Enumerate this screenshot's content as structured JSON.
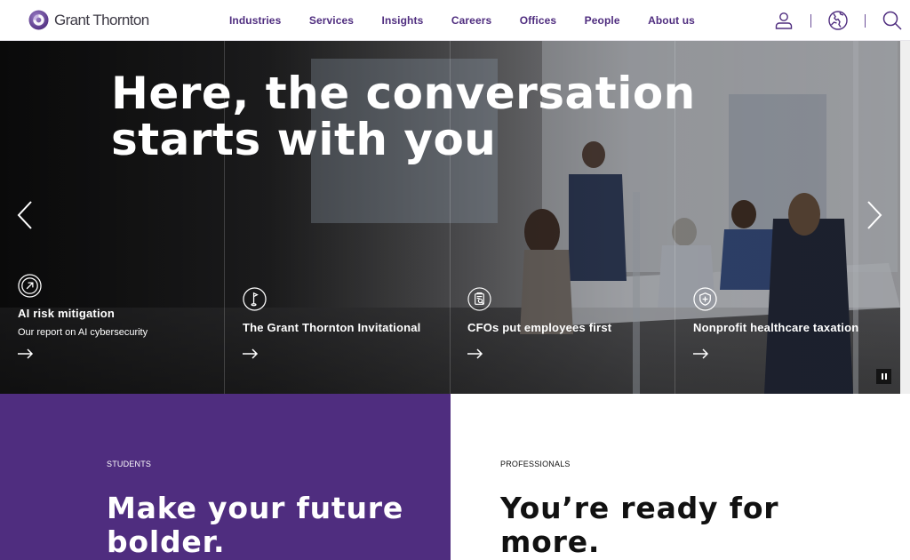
{
  "header": {
    "logo_text": "Grant Thornton",
    "nav": [
      "Industries",
      "Services",
      "Insights",
      "Careers",
      "Offices",
      "People",
      "About us"
    ],
    "utility_icons": [
      "user-icon",
      "globe-icon",
      "search-icon"
    ]
  },
  "hero": {
    "title": "Here, the conversation starts with you",
    "prev_icon": "chevron-left-icon",
    "next_icon": "chevron-right-icon",
    "pause_icon": "pause-icon",
    "panels": [
      {
        "icon": "arrow-up-right-circle-icon",
        "title": "AI risk mitigation",
        "subtitle": "Our report on AI cybersecurity",
        "link_icon": "arrow-right-icon"
      },
      {
        "icon": "golf-flag-circle-icon",
        "title": "The Grant Thornton Invitational",
        "subtitle": "",
        "link_icon": "arrow-right-icon"
      },
      {
        "icon": "clipboard-search-circle-icon",
        "title": "CFOs put employees first",
        "subtitle": "",
        "link_icon": "arrow-right-icon"
      },
      {
        "icon": "shield-plus-circle-icon",
        "title": "Nonprofit healthcare taxation",
        "subtitle": "",
        "link_icon": "arrow-right-icon"
      }
    ]
  },
  "students": {
    "eyebrow": "STUDENTS",
    "headline_line1": "Make your future",
    "headline_line2": "bolder."
  },
  "professionals": {
    "eyebrow": "PROFESSIONALS",
    "headline_line1": "You’re ready for",
    "headline_line2": "more."
  },
  "colors": {
    "brand_purple": "#4f2d7f",
    "nav_text": "#4f2d7f",
    "white": "#ffffff",
    "dark_text": "#111111"
  }
}
